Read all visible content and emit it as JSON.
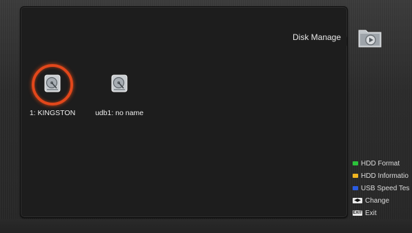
{
  "header": {
    "title": "Disk Manage",
    "icon": "folder-play-icon"
  },
  "disks": [
    {
      "label": "1: KINGSTON",
      "selected": true,
      "icon": "hdd-icon"
    },
    {
      "label": "udb1: no name",
      "selected": false,
      "icon": "hdd-icon"
    }
  ],
  "legend": [
    {
      "label": "HDD Format",
      "kind": "color",
      "color": "#2bc23a"
    },
    {
      "label": "HDD Informatio",
      "kind": "color",
      "color": "#f0b420"
    },
    {
      "label": "USB Speed Tes",
      "kind": "color",
      "color": "#2a5be0"
    },
    {
      "label": "Change",
      "kind": "key",
      "key": "◀▶"
    },
    {
      "label": "Exit",
      "kind": "key",
      "key": "EXIT"
    }
  ],
  "colors": {
    "selection_ring": "#e2471b",
    "panel_bg": "#1d1d1d"
  }
}
